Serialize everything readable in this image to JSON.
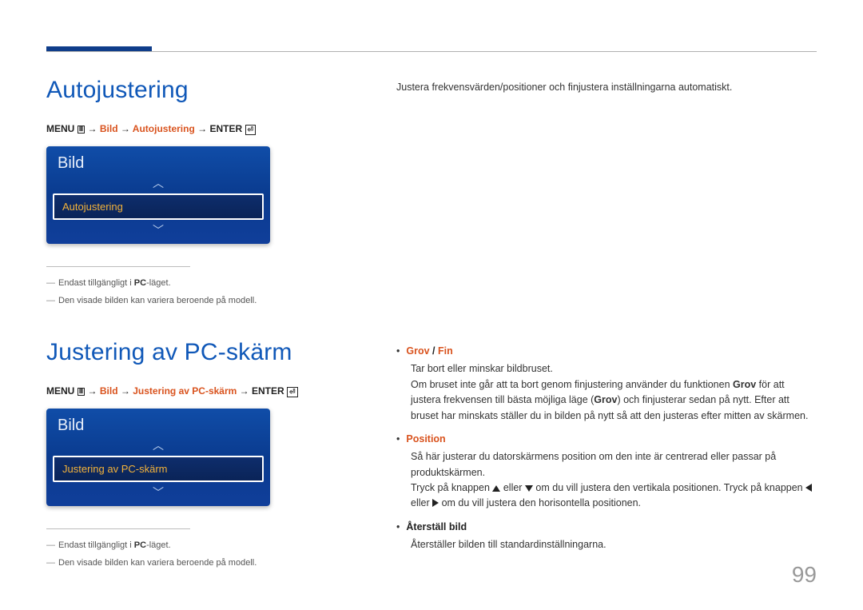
{
  "section1": {
    "title": "Autojustering",
    "breadcrumb": {
      "menu": "MENU",
      "path1": "Bild",
      "path2": "Autojustering",
      "enter": "ENTER"
    },
    "card": {
      "header": "Bild",
      "highlighted": "Autojustering"
    },
    "notes": {
      "line1_prefix": "Endast tillgängligt i ",
      "line1_bold": "PC",
      "line1_suffix": "-läget.",
      "line2": "Den visade bilden kan variera beroende på modell."
    },
    "rightDesc": "Justera frekvensvärden/positioner och finjustera inställningarna automatiskt."
  },
  "section2": {
    "title": "Justering av PC-skärm",
    "breadcrumb": {
      "menu": "MENU",
      "path1": "Bild",
      "path2": "Justering av PC-skärm",
      "enter": "ENTER"
    },
    "card": {
      "header": "Bild",
      "highlighted": "Justering av PC-skärm"
    },
    "notes": {
      "line1_prefix": "Endast tillgängligt i ",
      "line1_bold": "PC",
      "line1_suffix": "-läget.",
      "line2": "Den visade bilden kan variera beroende på modell."
    },
    "bullets": {
      "b1": {
        "head_a": "Grov",
        "head_sep": " / ",
        "head_b": "Fin",
        "p1": "Tar bort eller minskar bildbruset.",
        "p2a": "Om bruset inte går att ta bort genom finjustering använder du funktionen ",
        "p2b": "Grov",
        "p2c": " för att justera frekvensen till bästa möjliga läge (",
        "p2d": "Grov",
        "p2e": ") och finjusterar sedan på nytt. Efter att bruset har minskats ställer du in bilden på nytt så att den justeras efter mitten av skärmen."
      },
      "b2": {
        "head": "Position",
        "p1": "Så här justerar du datorskärmens position om den inte är centrerad eller passar på produktskärmen.",
        "p2a": "Tryck på knappen ",
        "p2b": " eller ",
        "p2c": " om du vill justera den vertikala positionen. Tryck på knappen ",
        "p2d": " eller ",
        "p2e": " om du vill justera den horisontella positionen."
      },
      "b3": {
        "head": "Återställ bild",
        "p1": "Återställer bilden till standardinställningarna."
      }
    }
  },
  "pageNumber": "99"
}
